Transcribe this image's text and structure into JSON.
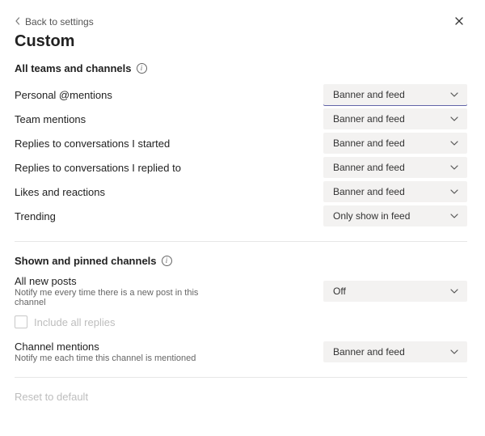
{
  "back_label": "Back to settings",
  "page_title": "Custom",
  "sections": {
    "all": {
      "header": "All teams and channels",
      "rows": [
        {
          "label": "Personal @mentions",
          "value": "Banner and feed"
        },
        {
          "label": "Team mentions",
          "value": "Banner and feed"
        },
        {
          "label": "Replies to conversations I started",
          "value": "Banner and feed"
        },
        {
          "label": "Replies to conversations I replied to",
          "value": "Banner and feed"
        },
        {
          "label": "Likes and reactions",
          "value": "Banner and feed"
        },
        {
          "label": "Trending",
          "value": "Only show in feed"
        }
      ]
    },
    "pinned": {
      "header": "Shown and pinned channels",
      "new_posts": {
        "label": "All new posts",
        "sub": "Notify me every time there is a new post in this channel",
        "value": "Off"
      },
      "include_all_replies": "Include all replies",
      "channel_mentions": {
        "label": "Channel mentions",
        "sub": "Notify me each time this channel is mentioned",
        "value": "Banner and feed"
      }
    }
  },
  "reset_label": "Reset to default"
}
